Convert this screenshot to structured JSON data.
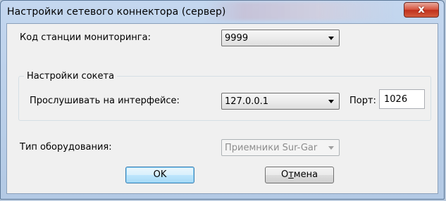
{
  "window": {
    "title": "Настройки сетевого коннектора (сервер)",
    "close_glyph": "x"
  },
  "form": {
    "station_code": {
      "label": "Код станции мониторинга:",
      "value": "9999"
    },
    "socket_group": {
      "legend": "Настройки сокета",
      "interface": {
        "label": "Прослушивать на интерфейсе:",
        "value": "127.0.0.1"
      },
      "port": {
        "label": "Порт:",
        "value": "1026"
      }
    },
    "equipment": {
      "label": "Тип оборудования:",
      "value": "Приемники Sur-Gar",
      "disabled": true
    }
  },
  "buttons": {
    "ok": "OK",
    "cancel_prefix": "О",
    "cancel_mnemonic": "т",
    "cancel_suffix": "мена"
  },
  "colors": {
    "frame": "#b9c9dc",
    "client_bg": "#f0f0f0",
    "close_button": "#c0301c",
    "default_button_border": "#3c7fb1"
  }
}
